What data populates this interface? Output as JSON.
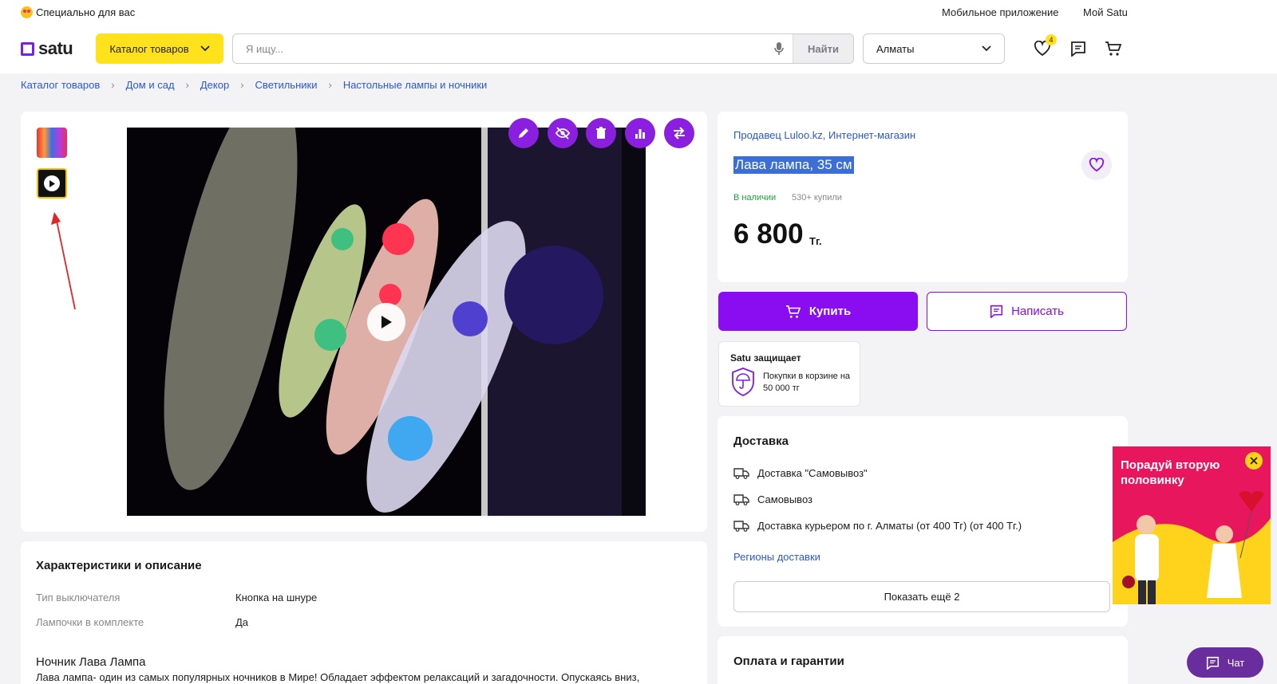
{
  "topbar": {
    "promo": "Специально для вас",
    "mobile_app": "Мобильное приложение",
    "my_satu": "Мой Satu"
  },
  "header": {
    "logo": "satu",
    "catalog_button": "Каталог товаров",
    "search_placeholder": "Я ищу...",
    "search_button": "Найти",
    "city": "Алматы",
    "favorites_count": "4"
  },
  "breadcrumbs": [
    "Каталог товаров",
    "Дом и сад",
    "Декор",
    "Светильники",
    "Настольные лампы и ночники"
  ],
  "product": {
    "seller": "Продавец Luloo.kz, Интернет-магазин",
    "title": "Лава лампа, 35 см",
    "stock": "В наличии",
    "bought": "530+ купили",
    "price": "6 800",
    "currency": "Тг."
  },
  "actions": {
    "buy": "Купить",
    "message": "Написать"
  },
  "protection": {
    "title": "Satu защищает",
    "text": "Покупки в корзине на 50 000 тг"
  },
  "delivery": {
    "title": "Доставка",
    "items": [
      "Доставка \"Самовывоз\"",
      "Самовывоз",
      "Доставка курьером по г. Алматы (от 400 Тг) (от 400 Тг.)"
    ],
    "regions": "Регионы доставки",
    "show_more": "Показать ещё 2"
  },
  "payment": {
    "title": "Оплата и гарантии"
  },
  "characteristics": {
    "title": "Характеристики и описание",
    "rows": [
      {
        "label": "Тип выключателя",
        "value": "Кнопка на шнуре"
      },
      {
        "label": "Лампочки в комплекте",
        "value": "Да"
      }
    ],
    "desc_title": "Ночник Лава Лампа",
    "desc_text": "Лава лампа- один из самых популярных ночников в  Мире! Обладает эффектом релаксаций и загадочности. Опускаясь вниз,"
  },
  "banner": {
    "text": "Порадуй вторую половинку"
  },
  "chat": {
    "label": "Чат"
  },
  "colors": {
    "accent": "#8a0cf0",
    "catalog_yellow": "#ffe21c",
    "link": "#2b57d9",
    "banner": "#e8175d"
  }
}
